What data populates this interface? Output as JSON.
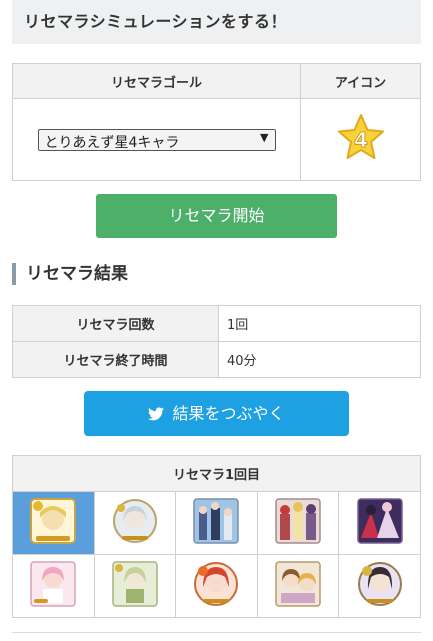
{
  "page": {
    "title": "リセマラシミュレーションをする！"
  },
  "goal_table": {
    "col_goal": "リセマラゴール",
    "col_icon": "アイコン",
    "select_value": "とりあえず星4キャラ",
    "star_value": "4",
    "star_color": "#f7d23a"
  },
  "start_button": {
    "label": "リセマラ開始",
    "color": "#4caf6a"
  },
  "results": {
    "heading": "リセマラ結果",
    "rows": [
      {
        "label": "リセマラ回数",
        "value": "1回"
      },
      {
        "label": "リセマラ終了時間",
        "value": "40分"
      }
    ]
  },
  "tweet_button": {
    "label": "結果をつぶやく",
    "icon": "twitter-bird-icon",
    "color": "#1da1e2"
  },
  "rounds": {
    "header": "リセマラ1回目",
    "cards": [
      {
        "icon": "character-card-icon",
        "selected": true
      },
      {
        "icon": "character-card-icon",
        "selected": false
      },
      {
        "icon": "character-card-icon",
        "selected": false
      },
      {
        "icon": "character-card-icon",
        "selected": false
      },
      {
        "icon": "character-card-icon",
        "selected": false
      },
      {
        "icon": "character-card-icon",
        "selected": false
      },
      {
        "icon": "character-card-icon",
        "selected": false
      },
      {
        "icon": "character-card-icon",
        "selected": false
      },
      {
        "icon": "character-card-icon",
        "selected": false
      },
      {
        "icon": "character-card-icon",
        "selected": false
      }
    ]
  }
}
